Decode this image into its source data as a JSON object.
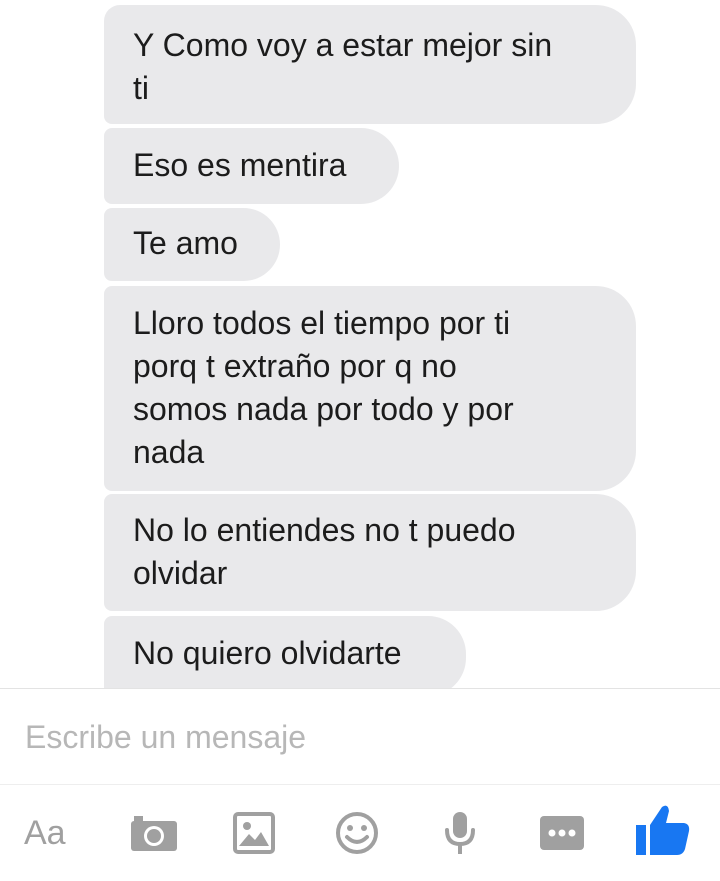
{
  "messages": [
    {
      "text": "Y Como voy a estar mejor sin\nti"
    },
    {
      "text": "Eso es mentira"
    },
    {
      "text": "Te amo"
    },
    {
      "text": "Lloro todos el tiempo por ti\nporq t extraño por q no\nsomos nada por todo y por\nnada"
    },
    {
      "text": "No lo entiendes no t puedo\nolvidar"
    },
    {
      "text": "No quiero olvidarte"
    }
  ],
  "composer": {
    "placeholder": "Escribe un mensaje"
  },
  "toolbar": {
    "aa_label": "Aa",
    "icons": [
      "text-format-icon",
      "camera-icon",
      "gallery-icon",
      "emoji-icon",
      "microphone-icon",
      "more-icon",
      "thumbs-up-icon"
    ]
  },
  "colors": {
    "bubble": "#e9e9eb",
    "icon_gray": "#a0a0a0",
    "accent_blue": "#1877f2"
  }
}
